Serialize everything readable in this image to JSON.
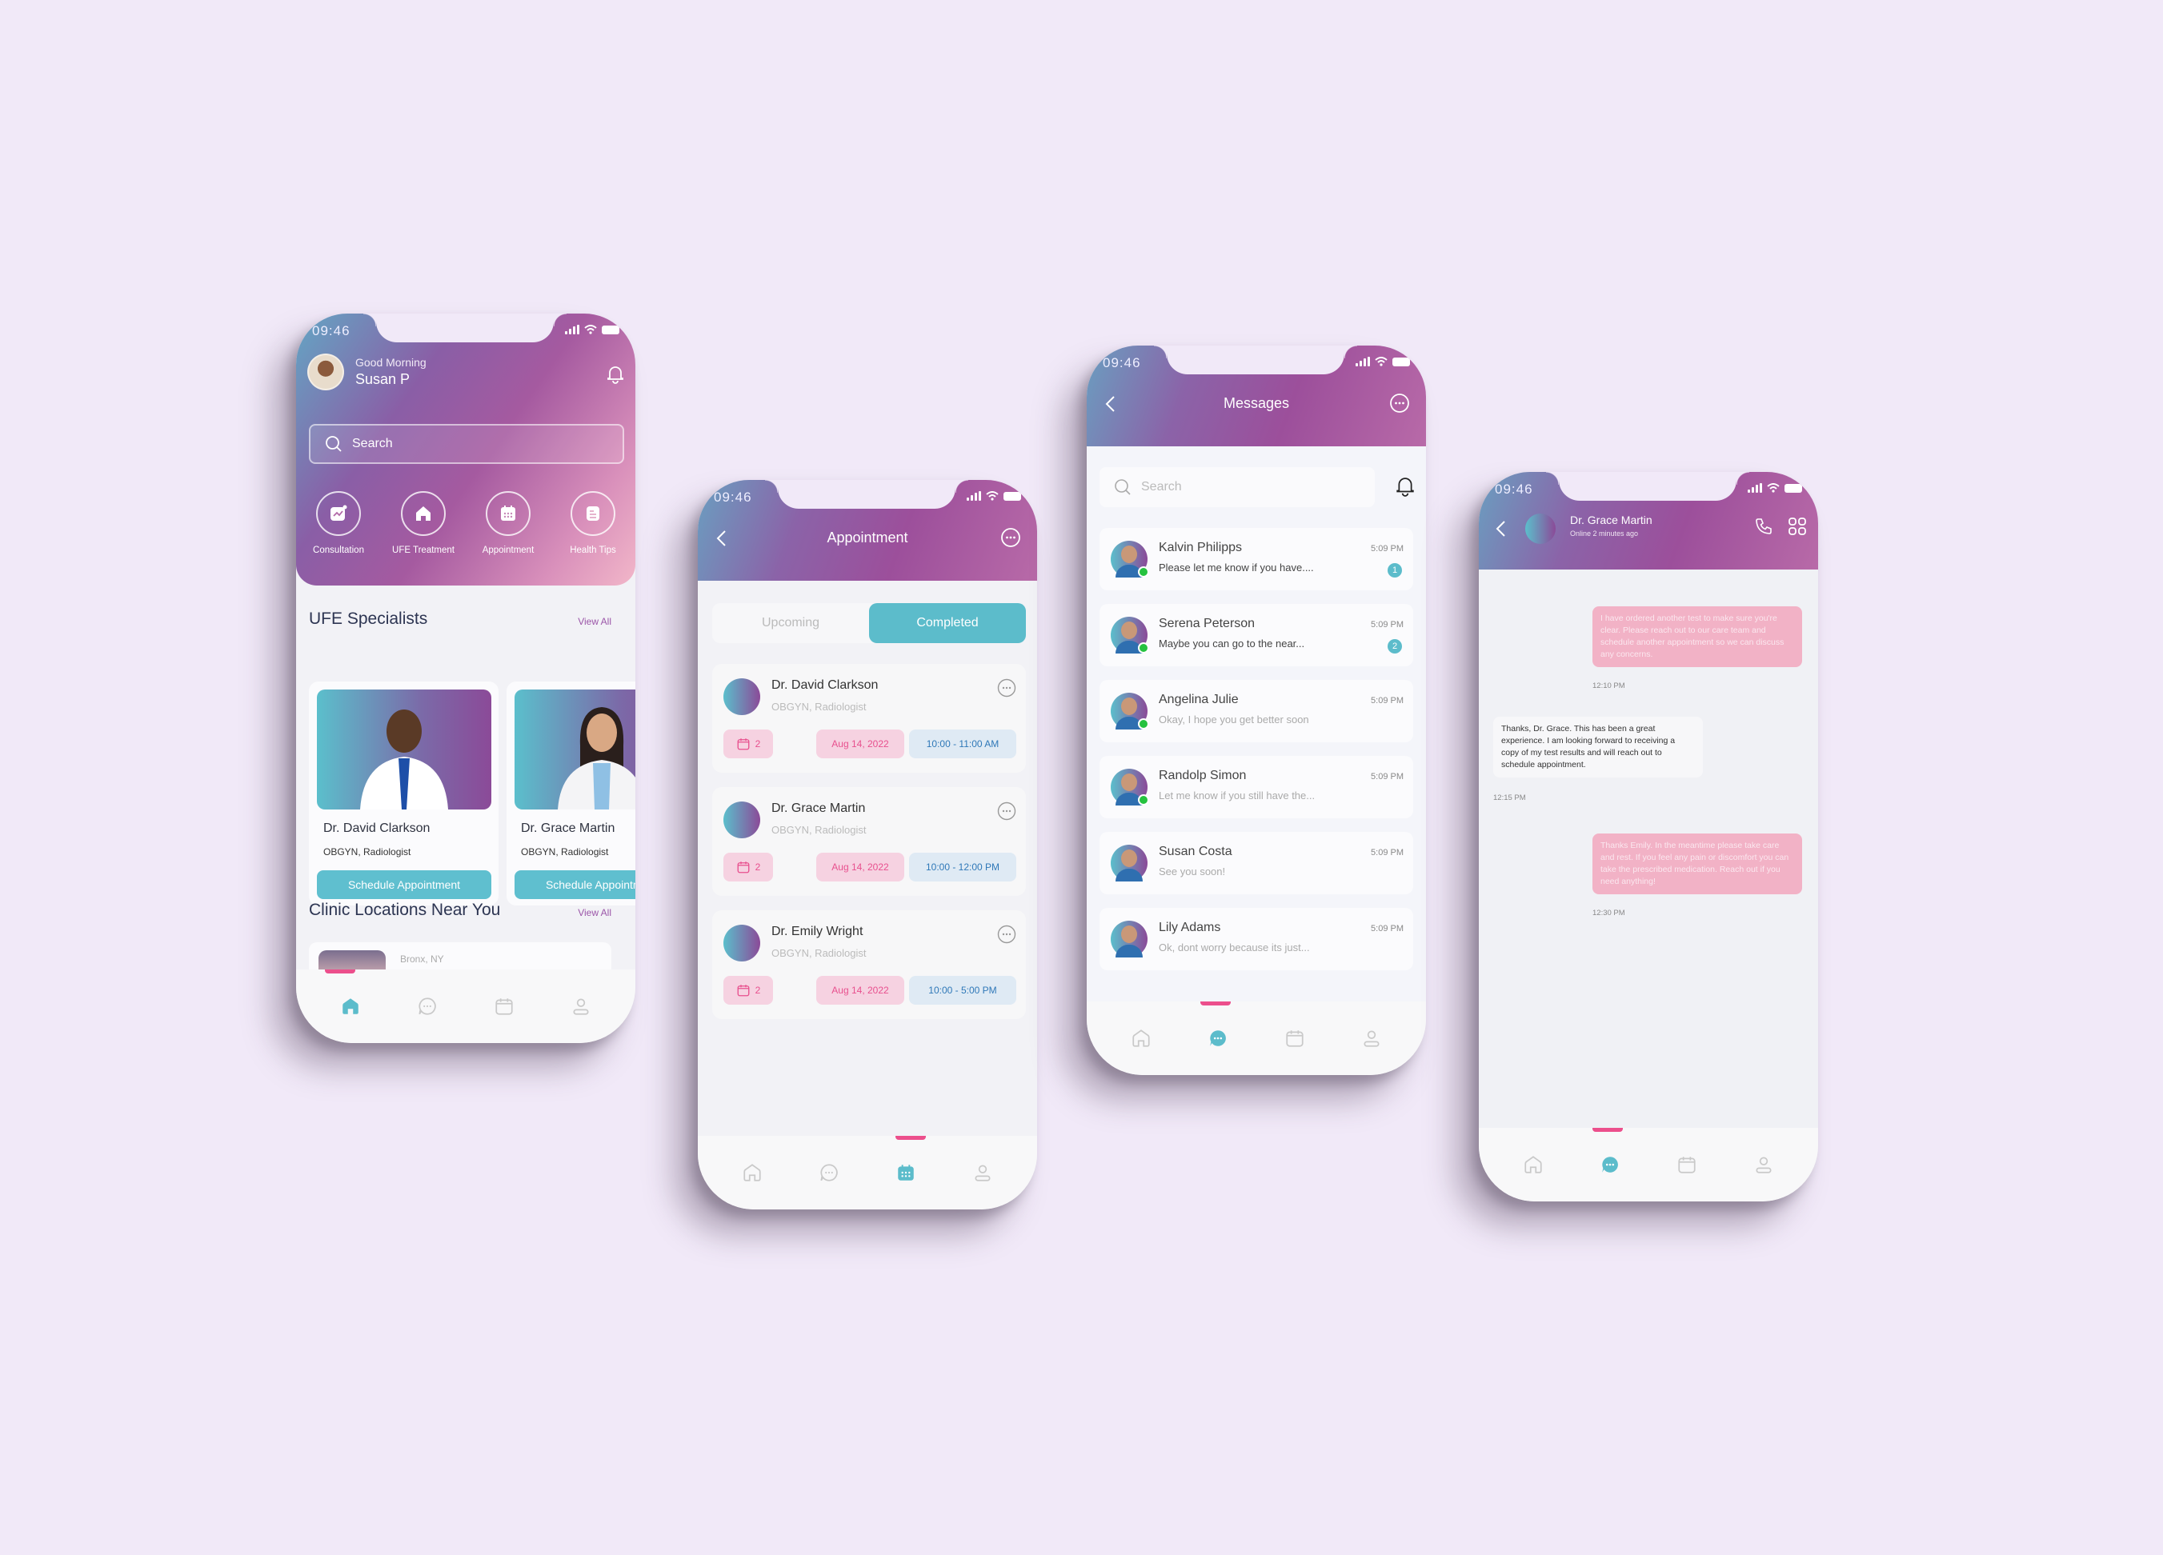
{
  "background_color": "#f1e9f8",
  "colors": {
    "accent_teal": "#5cbccb",
    "accent_pink": "#ec4f8c",
    "gradient_start": "#63a6c4",
    "gradient_mid": "#a55aa0",
    "gradient_end": "#f2b7c9"
  },
  "status_bar": {
    "time": "09:46"
  },
  "home": {
    "greeting": "Good Morning",
    "user_name": "Susan P",
    "search_placeholder": "Search",
    "quick_actions": [
      {
        "label": "Consultation",
        "icon": "chart-icon"
      },
      {
        "label": "UFE Treatment",
        "icon": "home-icon"
      },
      {
        "label": "Appointment",
        "icon": "calendar-icon"
      },
      {
        "label": "Health Tips",
        "icon": "document-icon"
      }
    ],
    "specialists_title": "UFE Specialists",
    "view_all": "View All",
    "specialists": [
      {
        "name": "Dr. David Clarkson",
        "specialty": "OBGYN, Radiologist",
        "button": "Schedule Appointment"
      },
      {
        "name": "Dr. Grace Martin",
        "specialty": "OBGYN, Radiologist",
        "button": "Schedule Appointment"
      }
    ],
    "clinics_title": "Clinic Locations Near You",
    "clinic_location": "Bronx, NY",
    "active_tab": "home"
  },
  "appointment": {
    "title": "Appointment",
    "tabs": [
      {
        "label": "Upcoming",
        "active": false
      },
      {
        "label": "Completed",
        "active": true
      }
    ],
    "items": [
      {
        "name": "Dr. David Clarkson",
        "specialty": "OBGYN, Radiologist",
        "count": "2",
        "date": "Aug 14, 2022",
        "time": "10:00 - 11:00 AM"
      },
      {
        "name": "Dr. Grace Martin",
        "specialty": "OBGYN, Radiologist",
        "count": "2",
        "date": "Aug 14, 2022",
        "time": "10:00 - 12:00 PM"
      },
      {
        "name": "Dr. Emily Wright",
        "specialty": "OBGYN, Radiologist",
        "count": "2",
        "date": "Aug 14, 2022",
        "time": "10:00 - 5:00 PM"
      }
    ],
    "active_tab": "calendar"
  },
  "messages": {
    "title": "Messages",
    "search_placeholder": "Search",
    "items": [
      {
        "name": "Kalvin Philipps",
        "preview": "Please let me know if you have....",
        "time": "5:09 PM",
        "unread": "1",
        "online": true
      },
      {
        "name": "Serena Peterson",
        "preview": "Maybe you can go to the near...",
        "time": "5:09 PM",
        "unread": "2",
        "online": true
      },
      {
        "name": "Angelina Julie",
        "preview": "Okay, I hope you get better soon",
        "time": "5:09 PM",
        "unread": null,
        "online": true
      },
      {
        "name": "Randolp Simon",
        "preview": "Let me know if you still have the...",
        "time": "5:09 PM",
        "unread": null,
        "online": true
      },
      {
        "name": "Susan Costa",
        "preview": "See you soon!",
        "time": "5:09 PM",
        "unread": null,
        "online": false
      },
      {
        "name": "Lily Adams",
        "preview": "Ok, dont worry because its just...",
        "time": "5:09 PM",
        "unread": null,
        "online": false
      }
    ],
    "active_tab": "chat"
  },
  "chat": {
    "contact_name": "Dr. Grace Martin",
    "contact_status": "Online 2 minutes ago",
    "messages": [
      {
        "direction": "out",
        "text": "I have ordered another test to make sure you're clear. Please reach out to our care team and schedule another appointment so we can discuss any concerns.",
        "time": "12:10 PM"
      },
      {
        "direction": "in",
        "text": "Thanks, Dr. Grace. This has been a great experience. I am looking forward to receiving a copy of my test results and will reach out to schedule appointment.",
        "time": "12:15 PM"
      },
      {
        "direction": "out",
        "text": "Thanks Emily. In the meantime please take care and rest. If you feel any pain or discomfort you can take the prescribed medication. Reach out if you need anything!",
        "time": "12:30 PM"
      }
    ],
    "active_tab": "chat"
  }
}
